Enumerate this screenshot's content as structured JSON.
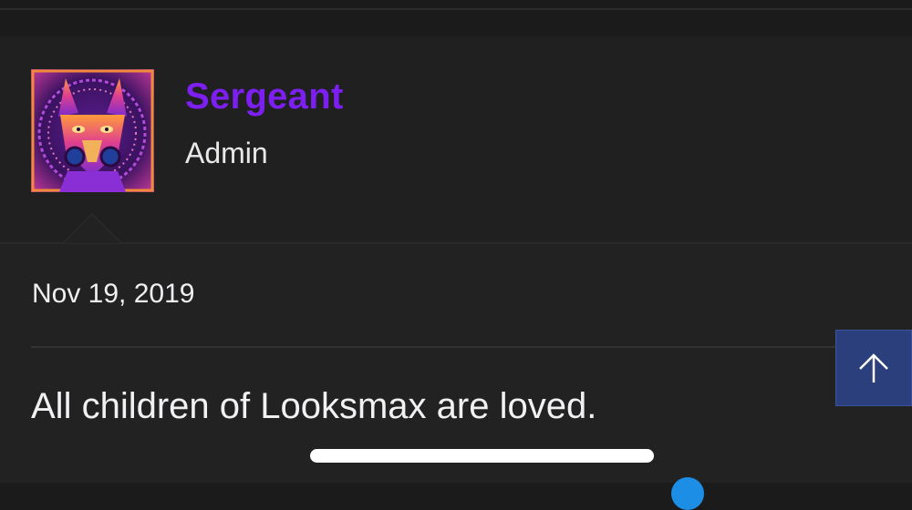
{
  "post": {
    "author": {
      "name": "Sergeant",
      "title": "Admin",
      "avatar_icon": "wolf-avatar-icon"
    },
    "date": "Nov 19, 2019",
    "message": "All children of Looksmax are loved."
  },
  "controls": {
    "scroll_top_icon": "arrow-up-icon"
  },
  "colors": {
    "username": "#7d1ff0",
    "scroll_button": "#2a3f7c",
    "background": "#222223"
  }
}
